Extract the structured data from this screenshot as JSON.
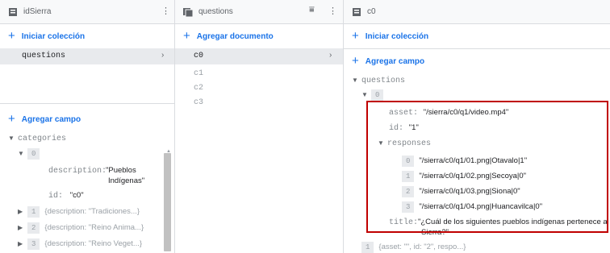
{
  "col1": {
    "title": "idSierra",
    "add_collection": "Iniciar colección",
    "collections": [
      "questions"
    ],
    "add_field": "Agregar campo",
    "categories_key": "categories",
    "item0_index": "0",
    "description_key": "description:",
    "description_val_line1": "\"Pueblos",
    "description_val_line2": "Indígenas\"",
    "id_key": "id:",
    "id_val": "\"c0\"",
    "collapsed_items": [
      {
        "index": "1",
        "text": "{description: \"Tradiciones...}"
      },
      {
        "index": "2",
        "text": "{description: \"Reino Anima...}"
      },
      {
        "index": "3",
        "text": "{description: \"Reino Veget...}"
      }
    ]
  },
  "col2": {
    "title": "questions",
    "add_document": "Agregar documento",
    "documents": [
      "c0",
      "c1",
      "c2",
      "c3"
    ]
  },
  "col3": {
    "title": "c0",
    "add_collection": "Iniciar colección",
    "add_field": "Agregar campo",
    "questions_key": "questions",
    "item0_index": "0",
    "asset_key": "asset:",
    "asset_val": "\"/sierra/c0/q1/video.mp4\"",
    "id_key": "id:",
    "id_val": "\"1\"",
    "responses_key": "responses",
    "responses": [
      {
        "index": "0",
        "text": "\"/sierra/c0/q1/01.png|Otavalo|1\""
      },
      {
        "index": "1",
        "text": "\"/sierra/c0/q1/02.png|Secoya|0\""
      },
      {
        "index": "2",
        "text": "\"/sierra/c0/q1/03.png|Siona|0\""
      },
      {
        "index": "3",
        "text": "\"/sierra/c0/q1/04.png|Huancavilca|0\""
      }
    ],
    "title_key": "title:",
    "title_val_line1": "\"¿Cuál de los siguientes pueblos indígenas pertenece a la",
    "title_val_line2": "Sierra?\"",
    "item1_index": "1",
    "item1_text": "{asset: \"\", id: \"2\", respo...}"
  }
}
